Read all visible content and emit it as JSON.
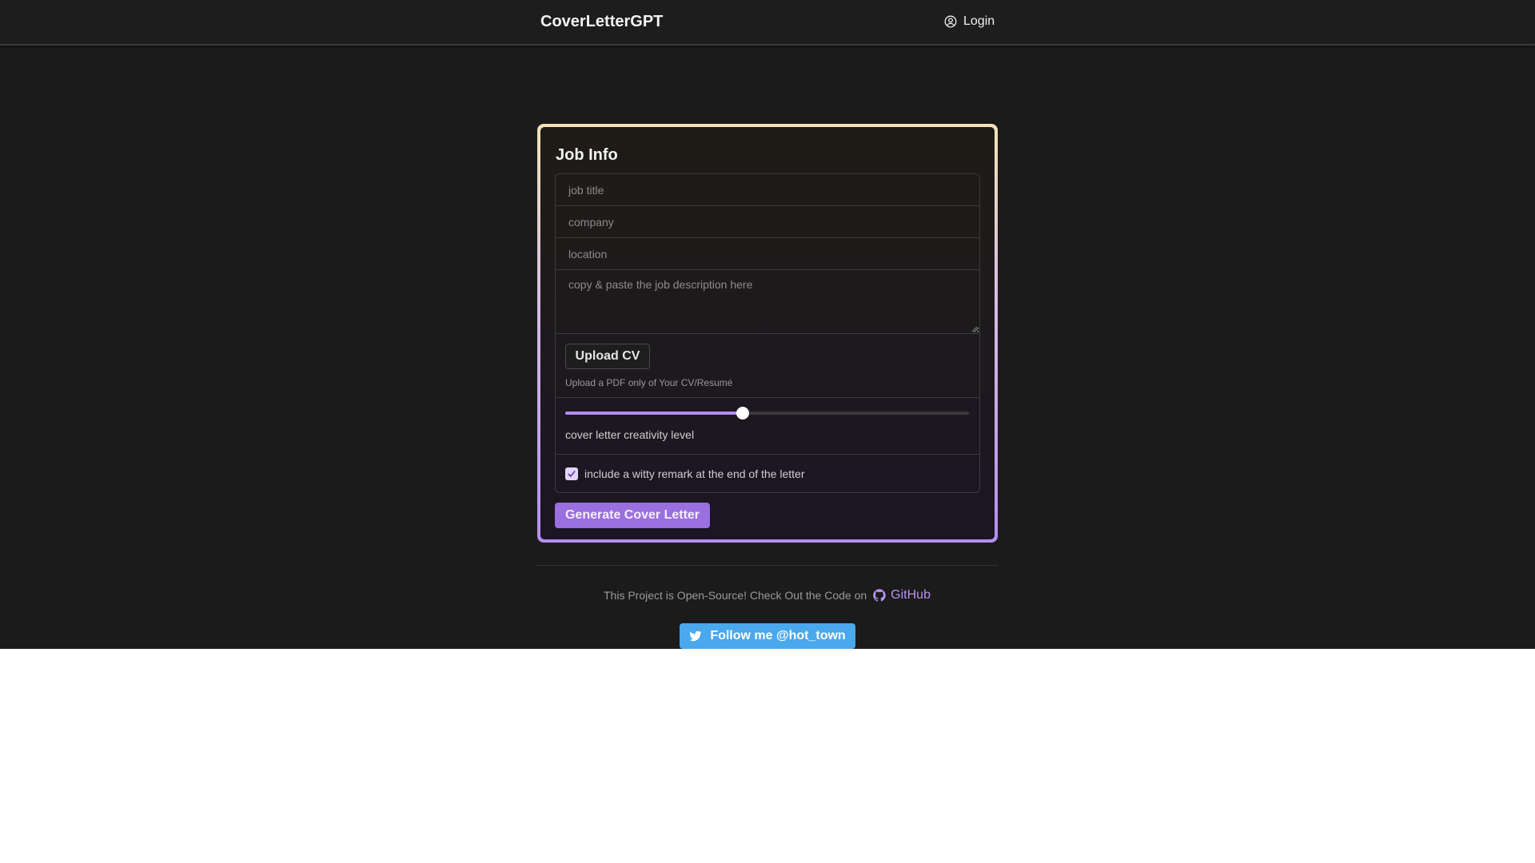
{
  "header": {
    "brand": "CoverLetterGPT",
    "login_label": "Login"
  },
  "card": {
    "title": "Job Info",
    "fields": {
      "job_title_placeholder": "job title",
      "company_placeholder": "company",
      "location_placeholder": "location",
      "description_placeholder": "copy & paste the job description here"
    },
    "upload": {
      "button_label": "Upload CV",
      "hint": "Upload a PDF only of Your CV/Resumé"
    },
    "creativity": {
      "label": "cover letter creativity level",
      "value_fraction": 0.44
    },
    "witty": {
      "label": "include a witty remark at the end of the letter",
      "checked": true
    },
    "generate_label": "Generate Cover Letter"
  },
  "footer": {
    "open_source_text": "This Project is Open-Source! Check Out the Code on",
    "github_label": "GitHub",
    "twitter_label": "Follow me @hot_town"
  },
  "colors": {
    "accent": "#9a6fe0",
    "twitter": "#4aa8ec",
    "background": "#1b1b1b"
  }
}
